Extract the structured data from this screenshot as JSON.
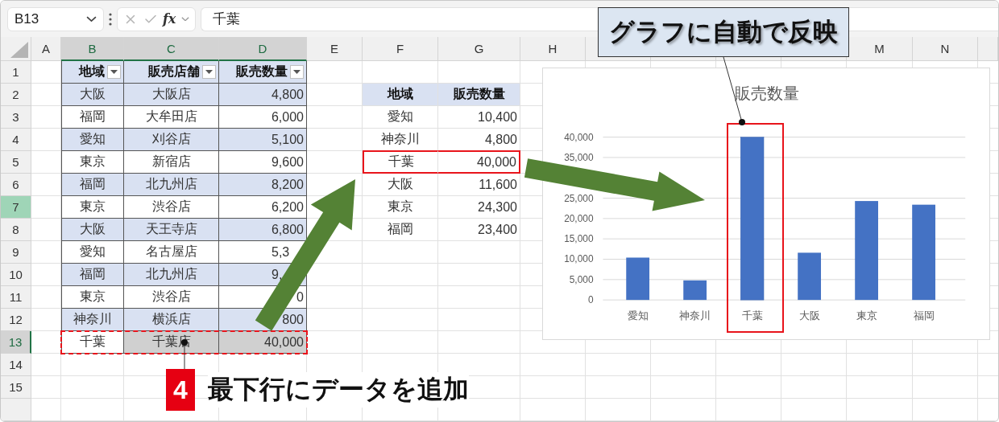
{
  "formula_bar": {
    "name_box": "B13",
    "fx": "fx",
    "formula": "千葉"
  },
  "column_headers": [
    {
      "label": "A",
      "selected": false
    },
    {
      "label": "B",
      "selected": true
    },
    {
      "label": "C",
      "selected": true
    },
    {
      "label": "D",
      "selected": true
    },
    {
      "label": "E",
      "selected": false
    },
    {
      "label": "F",
      "selected": false
    },
    {
      "label": "G",
      "selected": false
    },
    {
      "label": "H",
      "selected": false
    },
    {
      "selected": false
    },
    {
      "selected": false
    },
    {
      "selected": false
    },
    {
      "selected": false
    },
    {
      "label": "M",
      "selected": false
    },
    {
      "label": "N",
      "selected": false
    }
  ],
  "row_headers": [
    {
      "label": "1",
      "selected": false,
      "highlighted": false
    },
    {
      "label": "2",
      "selected": false,
      "highlighted": false
    },
    {
      "label": "3",
      "selected": false,
      "highlighted": false
    },
    {
      "label": "4",
      "selected": false,
      "highlighted": false
    },
    {
      "label": "5",
      "selected": false,
      "highlighted": false
    },
    {
      "label": "6",
      "selected": false,
      "highlighted": false
    },
    {
      "label": "7",
      "selected": false,
      "highlighted": true
    },
    {
      "label": "8",
      "selected": false,
      "highlighted": false
    },
    {
      "label": "9",
      "selected": false,
      "highlighted": false
    },
    {
      "label": "10",
      "selected": false,
      "highlighted": false
    },
    {
      "label": "11",
      "selected": false,
      "highlighted": false
    },
    {
      "label": "12",
      "selected": false,
      "highlighted": false
    },
    {
      "label": "13",
      "selected": true,
      "highlighted": false
    },
    {
      "label": "14",
      "selected": false,
      "highlighted": false
    },
    {
      "label": "15",
      "selected": false,
      "highlighted": false
    }
  ],
  "sales_table": {
    "columns": [
      "地域",
      "販売店舗",
      "販売数量"
    ],
    "rows": [
      {
        "cells": [
          "大阪",
          "大阪店",
          "4,800"
        ],
        "kind": "plain",
        "selected": false
      },
      {
        "cells": [
          "福岡",
          "大牟田店",
          "6,000"
        ],
        "kind": "plain",
        "selected": false
      },
      {
        "cells": [
          "愛知",
          "刈谷店",
          "5,100"
        ],
        "kind": "plain",
        "selected": false
      },
      {
        "cells": [
          "東京",
          "新宿店",
          "9,600"
        ],
        "kind": "plain",
        "selected": false
      },
      {
        "cells": [
          "福岡",
          "北九州店",
          "8,200"
        ],
        "kind": "plain",
        "selected": false
      },
      {
        "cells": [
          "東京",
          "渋谷店",
          "6,200"
        ],
        "kind": "plain",
        "selected": false
      },
      {
        "cells": [
          "大阪",
          "天王寺店",
          "6,800"
        ],
        "kind": "plain",
        "selected": false
      },
      {
        "cells": [
          "愛知",
          "名古屋店",
          "5,3"
        ],
        "kind": "cut_end",
        "selected": false
      },
      {
        "cells": [
          "福岡",
          "北九州店",
          "9,"
        ],
        "kind": "cut_end",
        "selected": false
      },
      {
        "cells": [
          "東京",
          "渋谷店",
          "0"
        ],
        "kind": "plain",
        "selected": false
      },
      {
        "cells": [
          "神奈川",
          "横浜店",
          "800"
        ],
        "kind": "plain",
        "selected": false
      },
      {
        "cells": [
          "千葉",
          "千葉店",
          "40,000"
        ],
        "kind": "plain",
        "selected": true
      }
    ]
  },
  "summary_table": {
    "columns": [
      "地域",
      "販売数量"
    ],
    "rows": [
      {
        "cells": [
          "愛知",
          "10,400"
        ],
        "highlighted": false
      },
      {
        "cells": [
          "神奈川",
          "4,800"
        ],
        "highlighted": false
      },
      {
        "cells": [
          "千葉",
          "40,000"
        ],
        "highlighted": true
      },
      {
        "cells": [
          "大阪",
          "11,600"
        ],
        "highlighted": false
      },
      {
        "cells": [
          "東京",
          "24,300"
        ],
        "highlighted": false
      },
      {
        "cells": [
          "福岡",
          "23,400"
        ],
        "highlighted": false
      }
    ]
  },
  "chart": {
    "highlights": [
      false,
      false,
      true,
      false,
      false,
      false
    ],
    "chart_data": {
      "type": "bar",
      "title": "販売数量",
      "categories": [
        "愛知",
        "神奈川",
        "千葉",
        "大阪",
        "東京",
        "福岡"
      ],
      "series": [
        {
          "color": "#4472c4",
          "values": [
            10400,
            4800,
            40000,
            11600,
            24300,
            23400
          ]
        }
      ],
      "ylim": [
        0,
        40000
      ],
      "grid": true,
      "yticks": [
        {
          "value": 0,
          "label": "0"
        },
        {
          "value": 5000,
          "label": "5,000"
        },
        {
          "value": 10000,
          "label": "10,000"
        },
        {
          "value": 15000,
          "label": "15,000"
        },
        {
          "value": 20000,
          "label": "20,000"
        },
        {
          "value": 25000,
          "label": "25,000"
        },
        {
          "value": 35000,
          "label": "35,000"
        },
        {
          "value": 40000,
          "label": "40,000"
        }
      ]
    }
  },
  "callout": {
    "text": "グラフに自動で反映"
  },
  "step": {
    "number": "4",
    "text": "最下行にデータを追加"
  }
}
